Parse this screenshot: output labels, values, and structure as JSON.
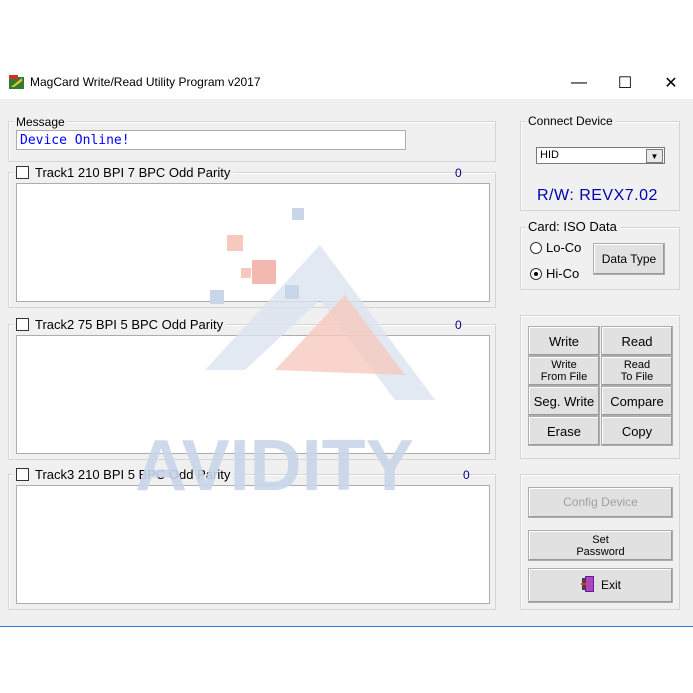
{
  "window": {
    "title": "MagCard Write/Read Utility Program  v2017",
    "minimize_glyph": "—",
    "maximize_glyph": "☐",
    "close_glyph": "✕"
  },
  "message": {
    "label": "Message",
    "value": "Device Online!"
  },
  "tracks": [
    {
      "label": "Track1   210 BPI  7 BPC  Odd Parity",
      "count": "0",
      "data": ""
    },
    {
      "label": "Track2   75 BPI  5 BPC  Odd Parity",
      "count": "0",
      "data": ""
    },
    {
      "label": "Track3   210 BPI  5 BPC  Odd Parity",
      "count": "0",
      "data": ""
    }
  ],
  "connect": {
    "label": "Connect Device",
    "selected": "HID",
    "version": "R/W: REVX7.02"
  },
  "card": {
    "label": "Card: ISO Data",
    "loco": "Lo-Co",
    "hico": "Hi-Co",
    "selected": "Hi-Co",
    "data_type": "Data Type"
  },
  "ops": {
    "write": "Write",
    "read": "Read",
    "write_file_1": "Write",
    "write_file_2": "From File",
    "read_file_1": "Read",
    "read_file_2": "To File",
    "seg_write": "Seg. Write",
    "compare": "Compare",
    "erase": "Erase",
    "copy": "Copy"
  },
  "config_device": "Config Device",
  "set_password_1": "Set",
  "set_password_2": "Password",
  "exit": "Exit",
  "watermark": {
    "text": "AVIDITY"
  },
  "colors": {
    "accent": "#0000ff",
    "version": "#0000b0",
    "watermark": "#c9d6ea",
    "watermark_red": "#f3b9b0"
  }
}
